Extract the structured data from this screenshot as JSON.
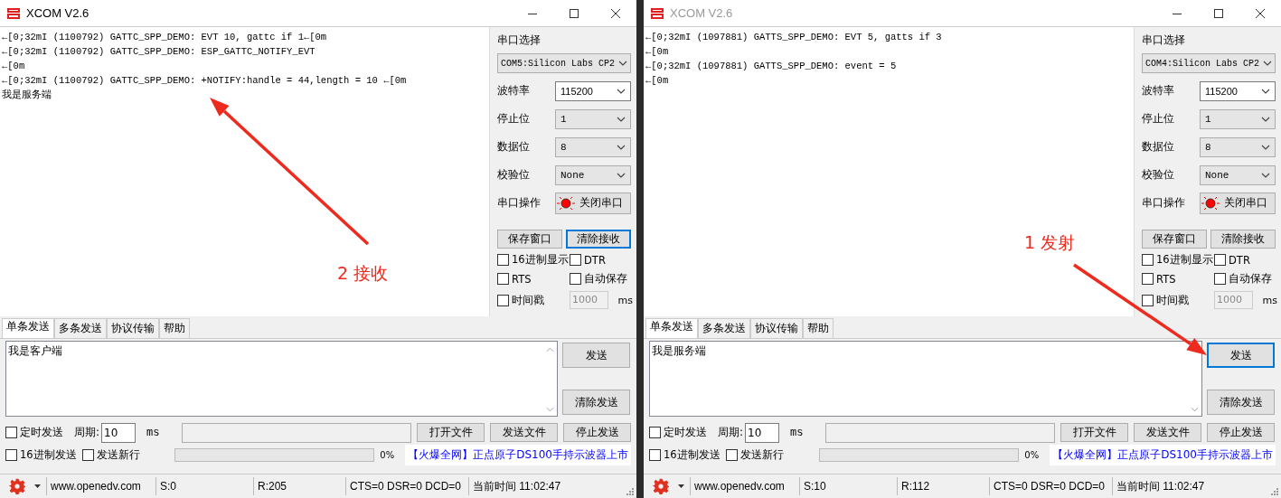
{
  "windows": [
    {
      "title": "XCOM V2.6",
      "active": true,
      "receive_lines": [
        "←[0;32mI (1100792) GATTC_SPP_DEMO: EVT 10, gattc if 1←[0m",
        "←[0;32mI (1100792) GATTC_SPP_DEMO: ESP_GATTC_NOTIFY_EVT",
        "←[0m",
        "←[0;32mI (1100792) GATTC_SPP_DEMO: +NOTIFY:handle = 44,length = 10 ←[0m",
        "我是服务端"
      ],
      "side": {
        "port_label": "串口选择",
        "port": "COM5:Silicon Labs CP2",
        "settings": [
          {
            "label": "波特率",
            "value": "115200",
            "kind": "combo"
          },
          {
            "label": "停止位",
            "value": "1",
            "kind": "dropdown"
          },
          {
            "label": "数据位",
            "value": "8",
            "kind": "dropdown"
          },
          {
            "label": "校验位",
            "value": "None",
            "kind": "dropdown"
          }
        ],
        "operation_label": "串口操作",
        "operation_button": "关闭串口",
        "buttons": [
          {
            "label": "保存窗口",
            "focused": false
          },
          {
            "label": "清除接收",
            "focused": true
          }
        ],
        "options": [
          {
            "label": "16进制显示",
            "checked": false
          },
          {
            "label": "DTR",
            "checked": false
          },
          {
            "label": "RTS",
            "checked": false
          },
          {
            "label": "自动保存",
            "checked": false
          },
          {
            "label": "时间戳",
            "checked": false
          }
        ],
        "interval": "1000",
        "interval_unit": "ms"
      },
      "tabs": [
        {
          "label": "单条发送",
          "selected": true
        },
        {
          "label": "多条发送",
          "selected": false
        },
        {
          "label": "协议传输",
          "selected": false
        },
        {
          "label": "帮助",
          "selected": false
        }
      ],
      "send_text": "我是客户端",
      "send_buttons": [
        {
          "label": "发送",
          "focused": false
        },
        {
          "label": "清除发送",
          "focused": false
        }
      ],
      "timed_send": {
        "label": "定时发送",
        "checked": false
      },
      "period_label": "周期:",
      "period": "10",
      "period_unit": "ms",
      "file_buttons": [
        "打开文件",
        "发送文件",
        "停止发送"
      ],
      "send_options": [
        {
          "label": "16进制发送",
          "checked": false
        },
        {
          "label": "发送新行",
          "checked": false
        }
      ],
      "progress": {
        "level": 0,
        "reading": "0%"
      },
      "ad": "【火爆全网】正点原子DS100手持示波器上市",
      "status": {
        "url": "www.openedv.com",
        "sent": "S:0",
        "received": "R:205",
        "lines": "CTS=0 DSR=0 DCD=0",
        "time": "当前时间 11:02:47"
      },
      "annotation": "2 接收"
    },
    {
      "title": "XCOM V2.6",
      "active": false,
      "receive_lines": [
        "←[0;32mI (1097881) GATTS_SPP_DEMO: EVT 5, gatts if 3",
        "←[0m",
        "←[0;32mI (1097881) GATTS_SPP_DEMO: event = 5",
        "←[0m"
      ],
      "side": {
        "port_label": "串口选择",
        "port": "COM4:Silicon Labs CP2",
        "settings": [
          {
            "label": "波特率",
            "value": "115200",
            "kind": "combo"
          },
          {
            "label": "停止位",
            "value": "1",
            "kind": "dropdown"
          },
          {
            "label": "数据位",
            "value": "8",
            "kind": "dropdown"
          },
          {
            "label": "校验位",
            "value": "None",
            "kind": "dropdown"
          }
        ],
        "operation_label": "串口操作",
        "operation_button": "关闭串口",
        "buttons": [
          {
            "label": "保存窗口",
            "focused": false
          },
          {
            "label": "清除接收",
            "focused": false
          }
        ],
        "options": [
          {
            "label": "16进制显示",
            "checked": false
          },
          {
            "label": "DTR",
            "checked": false
          },
          {
            "label": "RTS",
            "checked": false
          },
          {
            "label": "自动保存",
            "checked": false
          },
          {
            "label": "时间戳",
            "checked": false
          }
        ],
        "interval": "1000",
        "interval_unit": "ms"
      },
      "tabs": [
        {
          "label": "单条发送",
          "selected": true
        },
        {
          "label": "多条发送",
          "selected": false
        },
        {
          "label": "协议传输",
          "selected": false
        },
        {
          "label": "帮助",
          "selected": false
        }
      ],
      "send_text": "我是服务端",
      "send_buttons": [
        {
          "label": "发送",
          "focused": true
        },
        {
          "label": "清除发送",
          "focused": false
        }
      ],
      "timed_send": {
        "label": "定时发送",
        "checked": false
      },
      "period_label": "周期:",
      "period": "10",
      "period_unit": "ms",
      "file_buttons": [
        "打开文件",
        "发送文件",
        "停止发送"
      ],
      "send_options": [
        {
          "label": "16进制发送",
          "checked": false
        },
        {
          "label": "发送新行",
          "checked": false
        }
      ],
      "progress": {
        "level": 0,
        "reading": "0%"
      },
      "ad": "【火爆全网】正点原子DS100手持示波器上市",
      "status": {
        "url": "www.openedv.com",
        "sent": "S:10",
        "received": "R:112",
        "lines": "CTS=0 DSR=0 DCD=0",
        "time": "当前时间 11:02:47"
      },
      "annotation": "1 发射"
    }
  ]
}
